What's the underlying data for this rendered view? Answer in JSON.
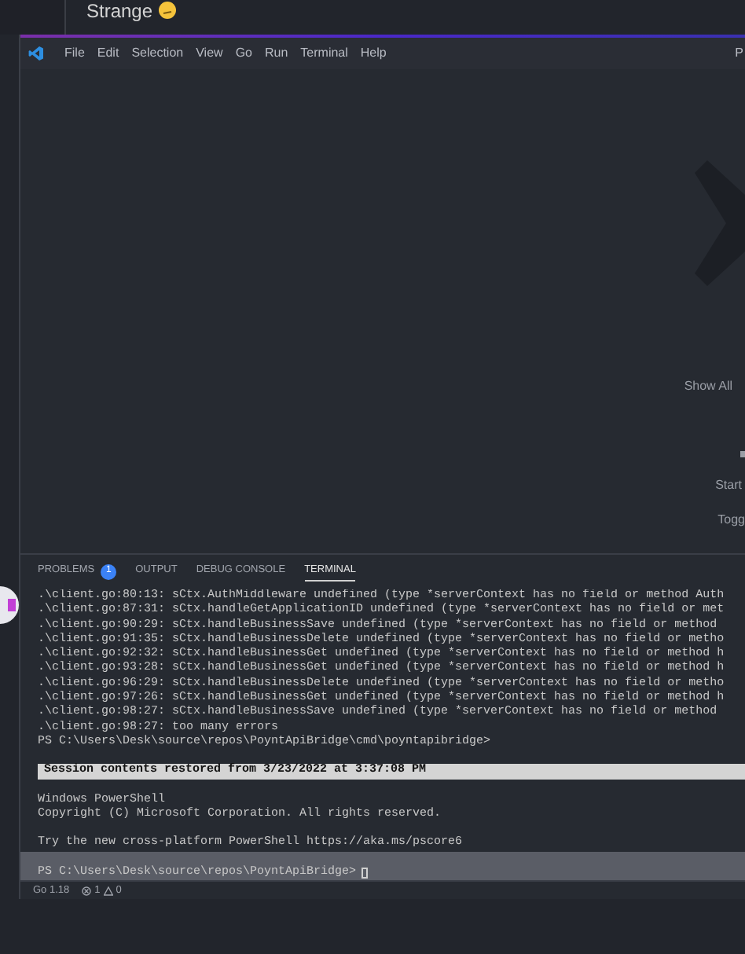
{
  "chat": {
    "message": "Strange"
  },
  "window": {
    "menu": [
      "File",
      "Edit",
      "Selection",
      "View",
      "Go",
      "Run",
      "Terminal",
      "Help"
    ],
    "title_fragment": "P"
  },
  "editor": {
    "links": [
      "Show All",
      "Start",
      "Togg"
    ]
  },
  "panel": {
    "tabs": [
      {
        "label": "PROBLEMS",
        "badge": "1",
        "selected": false
      },
      {
        "label": "OUTPUT",
        "selected": false
      },
      {
        "label": "DEBUG CONSOLE",
        "selected": false
      },
      {
        "label": "TERMINAL",
        "selected": true
      }
    ],
    "lines": [
      {
        "kind": "output",
        "text": ".\\client.go:80:13: sCtx.AuthMiddleware undefined (type *serverContext has no field or method Auth",
        "selected": false
      },
      {
        "kind": "output",
        "text": ".\\client.go:87:31: sCtx.handleGetApplicationID undefined (type *serverContext has no field or met",
        "selected": false
      },
      {
        "kind": "output",
        "text": ".\\client.go:90:29: sCtx.handleBusinessSave undefined (type *serverContext has no field or method",
        "selected": false
      },
      {
        "kind": "output",
        "text": ".\\client.go:91:35: sCtx.handleBusinessDelete undefined (type *serverContext has no field or metho",
        "selected": false
      },
      {
        "kind": "output",
        "text": ".\\client.go:92:32: sCtx.handleBusinessGet undefined (type *serverContext has no field or method h",
        "selected": false
      },
      {
        "kind": "output",
        "text": ".\\client.go:93:28: sCtx.handleBusinessGet undefined (type *serverContext has no field or method h",
        "selected": false
      },
      {
        "kind": "output",
        "text": ".\\client.go:96:29: sCtx.handleBusinessDelete undefined (type *serverContext has no field or metho",
        "selected": false
      },
      {
        "kind": "output",
        "text": ".\\client.go:97:26: sCtx.handleBusinessGet undefined (type *serverContext has no field or method h",
        "selected": false
      },
      {
        "kind": "output",
        "text": ".\\client.go:98:27: sCtx.handleBusinessSave undefined (type *serverContext has no field or method",
        "selected": false
      },
      {
        "kind": "output",
        "text": ".\\client.go:98:27: too many errors",
        "selected": false
      },
      {
        "kind": "output",
        "text": "PS C:\\Users\\Desk\\source\\repos\\PoyntApiBridge\\cmd\\poyntapibridge>",
        "selected": false
      },
      {
        "kind": "blank",
        "selected": false
      },
      {
        "kind": "banner",
        "text": "Session contents restored from 3/23/2022 at 3:37:08 PM",
        "selected": false
      },
      {
        "kind": "blank",
        "selected": false
      },
      {
        "kind": "output",
        "text": "Windows PowerShell",
        "selected": false
      },
      {
        "kind": "output",
        "text": "Copyright (C) Microsoft Corporation. All rights reserved.",
        "selected": false
      },
      {
        "kind": "blank",
        "selected": false
      },
      {
        "kind": "output",
        "text": "Try the new cross-platform PowerShell https://aka.ms/pscore6",
        "selected": false
      },
      {
        "kind": "blank",
        "selected": true
      },
      {
        "kind": "prompt",
        "text": "PS C:\\Users\\Desk\\source\\repos\\PoyntApiBridge>",
        "selected": true
      }
    ]
  },
  "status_bar": {
    "go_version": "Go 1.18",
    "errors": "1",
    "warnings": "0"
  }
}
